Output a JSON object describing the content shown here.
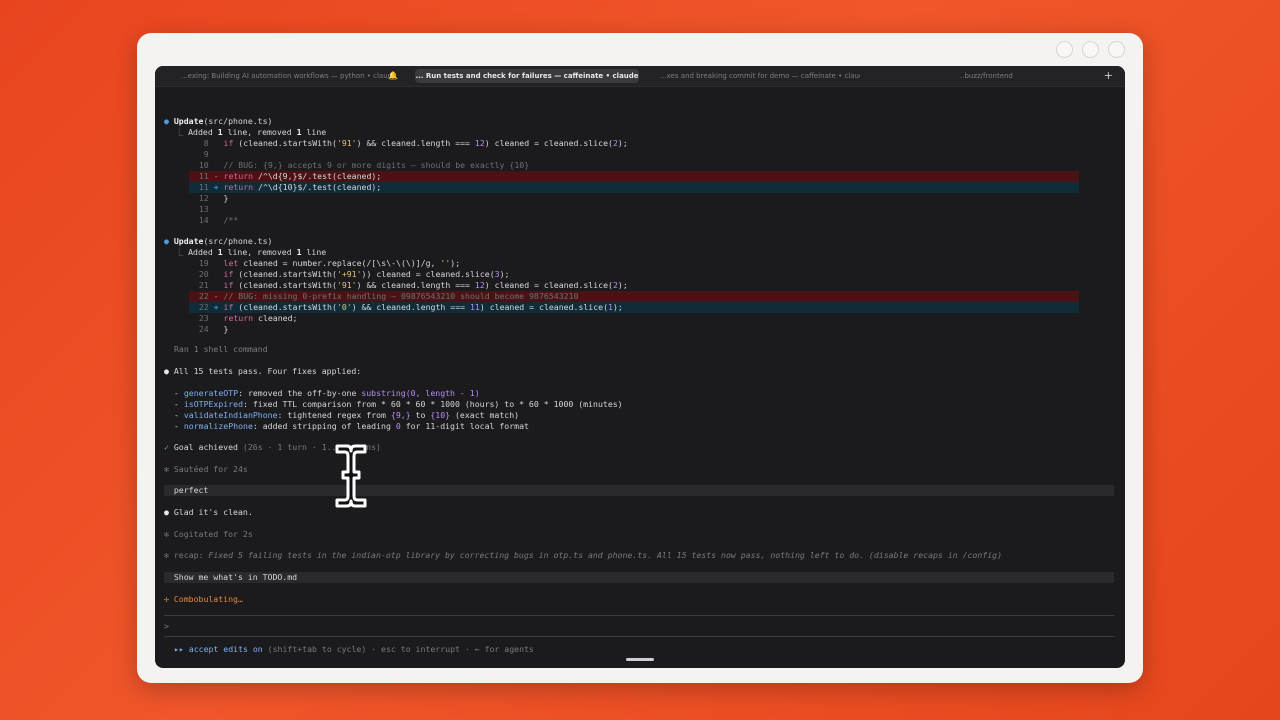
{
  "window": {
    "tabs": [
      {
        "label": "...exing: Building AI automation workflows — python • claude",
        "active": false
      },
      {
        "label": "... Run tests and check for failures — caffeinate • claude",
        "active": true
      },
      {
        "label": "...xes and breaking commit for demo — caffeinate • claude",
        "active": false
      },
      {
        "label": "..buzz/frontend",
        "active": false
      }
    ],
    "new_tab_icon": "plus-icon",
    "bell_icon": "bell-icon"
  },
  "edit1": {
    "title_bold": "Update",
    "title_rest": "(src/phone.ts)",
    "summary_a": "Added ",
    "summary_n1": "1",
    "summary_b": " line, removed ",
    "summary_n2": "1",
    "summary_c": " line",
    "lines": [
      {
        "n": "8",
        "mark": " ",
        "code": "if (cleaned.startsWith('91') && cleaned.length === 12) cleaned = cleaned.slice(2);"
      },
      {
        "n": "9",
        "mark": " ",
        "code": ""
      },
      {
        "n": "10",
        "mark": " ",
        "code": "// BUG: {9,} accepts 9 or more digits — should be exactly {10}"
      },
      {
        "n": "11",
        "mark": "-",
        "code": "return /^\\d{9,}$/.test(cleaned);"
      },
      {
        "n": "11",
        "mark": "+",
        "code": "return /^\\d{10}$/.test(cleaned);"
      },
      {
        "n": "12",
        "mark": " ",
        "code": "}"
      },
      {
        "n": "13",
        "mark": " ",
        "code": ""
      },
      {
        "n": "14",
        "mark": " ",
        "code": "/**"
      }
    ]
  },
  "edit2": {
    "title_bold": "Update",
    "title_rest": "(src/phone.ts)",
    "summary_a": "Added ",
    "summary_n1": "1",
    "summary_b": " line, removed ",
    "summary_n2": "1",
    "summary_c": " line",
    "lines": [
      {
        "n": "19",
        "mark": " ",
        "code": "let cleaned = number.replace(/[\\s\\-\\(\\)]/g, '');"
      },
      {
        "n": "20",
        "mark": " ",
        "code": "if (cleaned.startsWith('+91')) cleaned = cleaned.slice(3);"
      },
      {
        "n": "21",
        "mark": " ",
        "code": "if (cleaned.startsWith('91') && cleaned.length === 12) cleaned = cleaned.slice(2);"
      },
      {
        "n": "22",
        "mark": "-",
        "code": "// BUG: missing 0-prefix handling — 09876543210 should become 9876543210"
      },
      {
        "n": "22",
        "mark": "+",
        "code": "if (cleaned.startsWith('0') && cleaned.length === 11) cleaned = cleaned.slice(1);"
      },
      {
        "n": "23",
        "mark": " ",
        "code": "return cleaned;"
      },
      {
        "n": "24",
        "mark": " ",
        "code": "}"
      }
    ]
  },
  "shell": "Ran 1 shell command",
  "result": {
    "headline": "All 15 tests pass. Four fixes applied:",
    "fixes": [
      {
        "fn": "generateOTP",
        "text": ": removed the off-by-one ",
        "code": "substring(0, length - 1)"
      },
      {
        "fn": "isOTPExpired",
        "text": ": fixed TTL comparison from ",
        "code": "* 60 * 60 * 1000",
        "text2": " (hours) to ",
        "code2": "* 60 * 1000",
        "text3": " (minutes)"
      },
      {
        "fn": "validateIndianPhone",
        "text": ": tightened regex from ",
        "code": "{9,}",
        "text2": " to ",
        "code2": "{10}",
        "text3": " (exact match)"
      },
      {
        "fn": "normalizePhone",
        "text": ": added stripping of leading ",
        "code": "0",
        "text2": " for 11-digit local format"
      }
    ]
  },
  "goal": {
    "label": "Goal achieved",
    "meta": "(26s · 1 turn · 1... tokens)"
  },
  "sauteed": "Sautéed for 24s",
  "user1": "perfect",
  "reply": "Glad it's clean.",
  "cogitated": "Cogitated for 2s",
  "recap": {
    "label": "recap:",
    "text": "Fixed 5 failing tests in the indian-otp library by correcting bugs in otp.ts and phone.ts. All 15 tests now pass, nothing left to do. (disable recaps in /config)"
  },
  "user2": "Show me what's in TODO.md",
  "status": "Combobulating…",
  "prompt_char": ">",
  "footer": {
    "arrows": "▸▸",
    "mode": "accept edits on",
    "rest": " (shift+tab to cycle) · esc to interrupt · ← for agents"
  },
  "colors": {
    "background": "#e8451f",
    "terminal": "#1b1b1d",
    "accent_orange": "#e8853f",
    "bullet_blue": "#4a9ee8"
  }
}
